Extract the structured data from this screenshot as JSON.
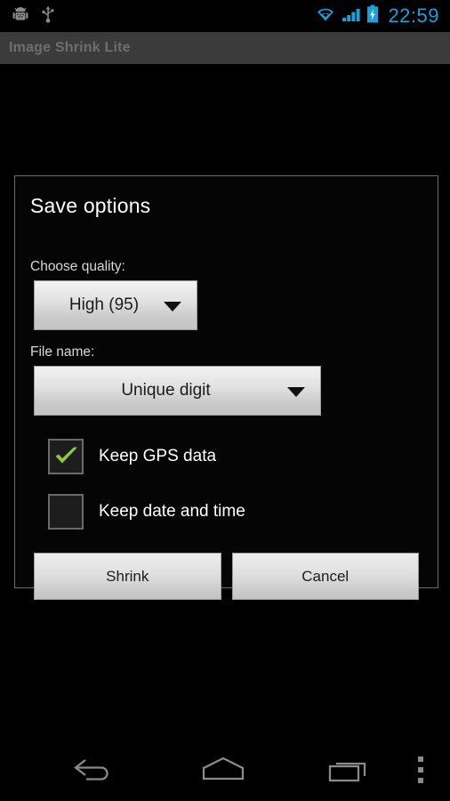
{
  "status_bar": {
    "left_icons": [
      "android-debug-icon",
      "usb-icon"
    ],
    "right_icons": [
      "wifi-icon",
      "signal-icon",
      "battery-charging-icon"
    ],
    "clock": "22:59",
    "clock_color": "#1d9fd8"
  },
  "title_bar": {
    "app_title": "Image Shrink Lite"
  },
  "dialog": {
    "title": "Save options",
    "quality": {
      "label": "Choose quality:",
      "selected": "High (95)"
    },
    "filename": {
      "label": "File name:",
      "selected": "Unique digit"
    },
    "checkboxes": [
      {
        "label": "Keep GPS data",
        "checked": true
      },
      {
        "label": "Keep date and time",
        "checked": false
      }
    ],
    "buttons": {
      "primary": "Shrink",
      "secondary": "Cancel"
    },
    "checkmark_color": "#8fc73e"
  },
  "nav_bar": {
    "back": "back-icon",
    "home": "home-icon",
    "recents": "recents-icon",
    "overflow": "overflow-menu-icon"
  }
}
